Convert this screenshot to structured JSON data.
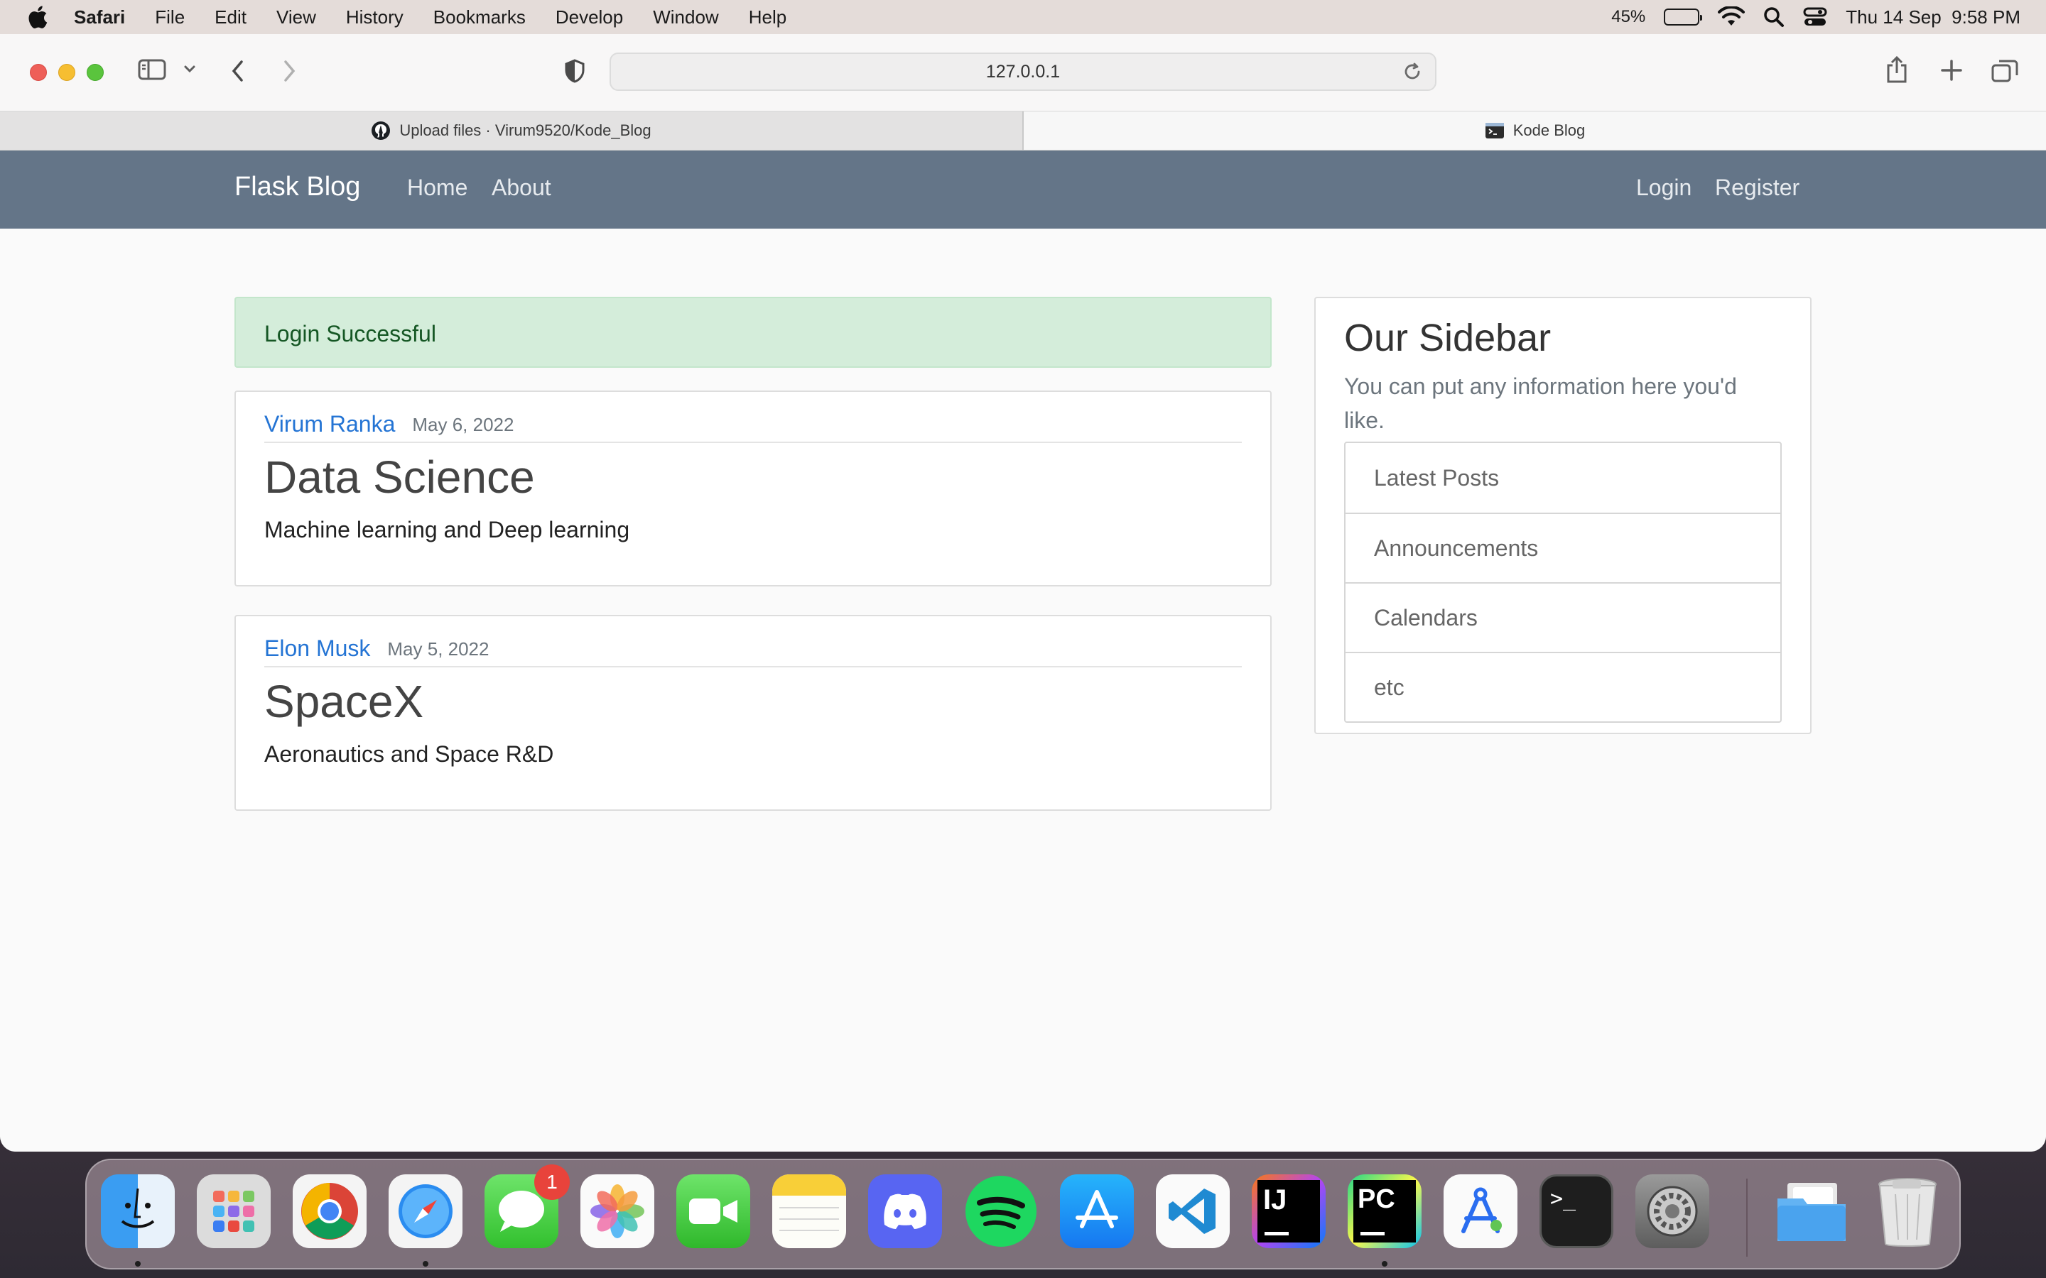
{
  "menubar": {
    "app_name": "Safari",
    "items": [
      "File",
      "Edit",
      "View",
      "History",
      "Bookmarks",
      "Develop",
      "Window",
      "Help"
    ],
    "battery_percent": "45%",
    "battery_level": 0.45,
    "datetime": "Thu 14 Sep  9:58 PM"
  },
  "browser": {
    "url": "127.0.0.1",
    "tabs": [
      {
        "title": "Upload files · Virum9520/Kode_Blog",
        "favicon": "github-icon"
      },
      {
        "title": "Kode Blog",
        "favicon": "terminal-icon"
      }
    ]
  },
  "site": {
    "brand": "Flask Blog",
    "nav_left": [
      "Home",
      "About"
    ],
    "nav_right": [
      "Login",
      "Register"
    ],
    "alert": "Login Successful",
    "posts": [
      {
        "author": "Virum Ranka",
        "date": "May 6, 2022",
        "title": "Data Science",
        "content": "Machine learning and Deep learning"
      },
      {
        "author": "Elon Musk",
        "date": "May 5, 2022",
        "title": "SpaceX",
        "content": "Aeronautics and Space R&D"
      }
    ],
    "sidebar": {
      "title": "Our Sidebar",
      "text": "You can put any information here you'd like.",
      "items": [
        "Latest Posts",
        "Announcements",
        "Calendars",
        "etc"
      ]
    }
  },
  "dock": {
    "apps": [
      "finder",
      "launchpad",
      "chrome",
      "safari",
      "messages",
      "photos",
      "facetime",
      "notes",
      "discord",
      "spotify",
      "app-store",
      "vscode",
      "intellij",
      "pycharm",
      "instruments",
      "terminal",
      "system-settings",
      "downloads-folder",
      "trash"
    ],
    "messages_badge": "1"
  },
  "colors": {
    "navbar": "#647588",
    "alert_bg": "#d4edda",
    "link": "#2474d4"
  }
}
